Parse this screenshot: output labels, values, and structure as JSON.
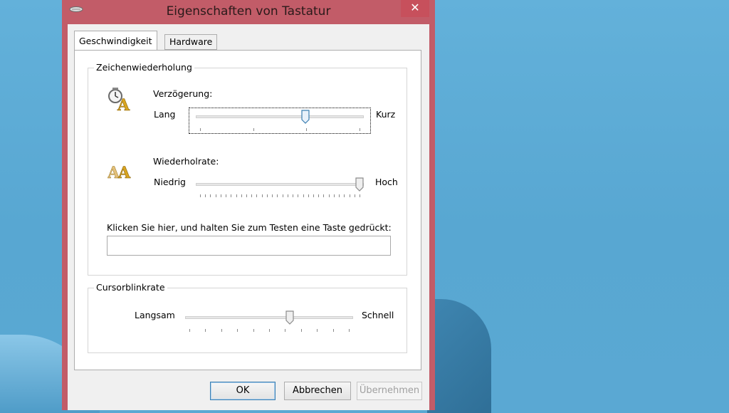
{
  "window": {
    "title": "Eigenschaften von Tastatur",
    "close_glyph": "✕"
  },
  "tabs": [
    {
      "label": "Geschwindigkeit",
      "active": true
    },
    {
      "label": "Hardware",
      "active": false
    }
  ],
  "repeat_group": {
    "label": "Zeichenwiederholung",
    "delay": {
      "label": "Verzögerung:",
      "min_label": "Lang",
      "max_label": "Kurz",
      "icon": "delay-clock-a-icon",
      "value_fraction": 0.66,
      "tick_count": 4
    },
    "rate": {
      "label": "Wiederholrate:",
      "min_label": "Niedrig",
      "max_label": "Hoch",
      "icon": "repeat-rate-aa-icon",
      "value_fraction": 1.0,
      "tick_count": 32
    },
    "test_label": "Klicken Sie hier, und halten Sie zum Testen eine Taste gedrückt:",
    "test_value": ""
  },
  "blink_group": {
    "label": "Cursorblinkrate",
    "min_label": "Langsam",
    "max_label": "Schnell",
    "value_fraction": 0.63,
    "tick_count": 11
  },
  "buttons": {
    "ok": "OK",
    "cancel": "Abbrechen",
    "apply": "Übernehmen"
  },
  "colors": {
    "titlebar": "#c25c68",
    "accent_thumb": "#3c7fb1"
  }
}
